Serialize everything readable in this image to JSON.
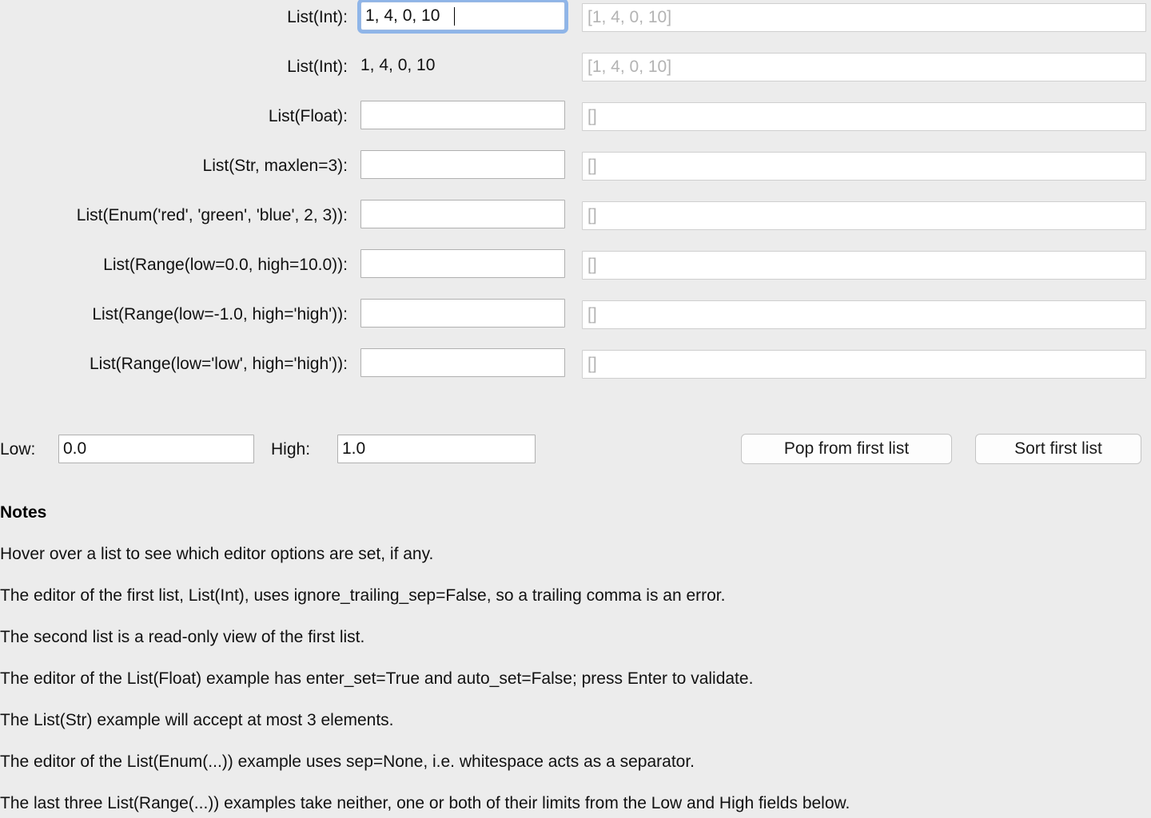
{
  "rows": [
    {
      "label": "List(Int):",
      "editor_kind": "input",
      "value": "1, 4, 0, 10",
      "focused": true,
      "readonly_value": "[1, 4, 0, 10]"
    },
    {
      "label": "List(Int):",
      "editor_kind": "text",
      "value": "1, 4, 0, 10",
      "focused": false,
      "readonly_value": "[1, 4, 0, 10]"
    },
    {
      "label": "List(Float):",
      "editor_kind": "input",
      "value": "",
      "focused": false,
      "readonly_value": "[]"
    },
    {
      "label": "List(Str, maxlen=3):",
      "editor_kind": "input",
      "value": "",
      "focused": false,
      "readonly_value": "[]"
    },
    {
      "label": "List(Enum('red', 'green', 'blue', 2, 3)):",
      "editor_kind": "input",
      "value": "",
      "focused": false,
      "readonly_value": "[]"
    },
    {
      "label": "List(Range(low=0.0, high=10.0)):",
      "editor_kind": "input",
      "value": "",
      "focused": false,
      "readonly_value": "[]"
    },
    {
      "label": "List(Range(low=-1.0, high='high')):",
      "editor_kind": "input",
      "value": "",
      "focused": false,
      "readonly_value": "[]"
    },
    {
      "label": "List(Range(low='low', high='high')):",
      "editor_kind": "input",
      "value": "",
      "focused": false,
      "readonly_value": "[]"
    }
  ],
  "limits": {
    "low_label": "Low:",
    "low_value": "0.0",
    "high_label": "High:",
    "high_value": "1.0"
  },
  "buttons": {
    "pop": "Pop from first list",
    "sort": "Sort first list"
  },
  "notes": {
    "title": "Notes",
    "lines": [
      "Hover over a list to see which editor options are set, if any.",
      "The editor of the first list, List(Int), uses ignore_trailing_sep=False, so a trailing comma is an error.",
      "The second list is a read-only view of the first list.",
      "The editor of the List(Float) example has enter_set=True and auto_set=False; press Enter to validate.",
      "The List(Str) example will accept at most 3 elements.",
      "The editor of the List(Enum(...)) example uses sep=None, i.e. whitespace acts as a separator.",
      "The last three List(Range(...)) examples take neither, one or both of their limits from the Low and High fields below."
    ]
  },
  "colors": {
    "background": "#ececec",
    "focus_ring": "#8fb5e8",
    "field_border": "#b0b0b0",
    "readonly_text": "#b3b3b3"
  }
}
